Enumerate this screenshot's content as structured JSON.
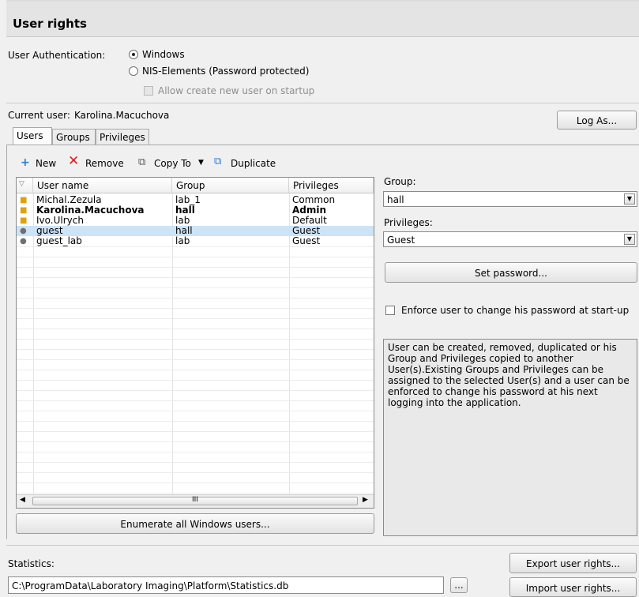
{
  "title": "User rights",
  "auth": {
    "label": "User Authentication:",
    "options": [
      {
        "label": "Windows",
        "selected": true
      },
      {
        "label": "NIS-Elements (Password protected)",
        "selected": false
      }
    ],
    "allow_create_label": "Allow create new user on startup"
  },
  "current_user": {
    "label": "Current user:",
    "value": "Karolina.Macuchova"
  },
  "log_as_label": "Log As...",
  "tabs": [
    {
      "label": "Users",
      "active": true
    },
    {
      "label": "Groups",
      "active": false
    },
    {
      "label": "Privileges",
      "active": false
    }
  ],
  "toolbar": {
    "new_label": "New",
    "remove_label": "Remove",
    "copy_to_label": "Copy To",
    "duplicate_label": "Duplicate"
  },
  "table": {
    "columns": [
      "User name",
      "Group",
      "Privileges"
    ],
    "rows": [
      {
        "user": "Michal.Zezula",
        "group": "lab_1",
        "privileges": "Common",
        "icon": "windows-user-icon",
        "bold": false,
        "selected": false
      },
      {
        "user": "Karolina.Macuchova",
        "group": "hall",
        "privileges": "Admin",
        "icon": "windows-user-icon",
        "bold": true,
        "selected": false
      },
      {
        "user": "Ivo.Ulrych",
        "group": "lab",
        "privileges": "Default",
        "icon": "windows-user-icon",
        "bold": false,
        "selected": false
      },
      {
        "user": "guest",
        "group": "hall",
        "privileges": "Guest",
        "icon": "local-user-icon",
        "bold": false,
        "selected": true
      },
      {
        "user": "guest_lab",
        "group": "lab",
        "privileges": "Guest",
        "icon": "local-user-icon",
        "bold": false,
        "selected": false
      }
    ],
    "scrollbar_grip": "III"
  },
  "enumerate_label": "Enumerate all Windows users...",
  "right_panel": {
    "group_label": "Group:",
    "group_value": "hall",
    "privileges_label": "Privileges:",
    "privileges_value": "Guest",
    "set_password_label": "Set password...",
    "enforce_label": "Enforce user to change his password at start-up",
    "help_text": "User can be created, removed, duplicated or his Group and Privileges copied to another User(s).Existing Groups and Privileges can be assigned to the selected User(s) and a user can be enforced to change his password at his next logging into the application."
  },
  "statistics": {
    "label": "Statistics:",
    "path": "C:\\ProgramData\\Laboratory Imaging\\Platform\\Statistics.db",
    "browse_label": "...",
    "export_label": "Export user rights...",
    "import_label": "Import user rights..."
  },
  "colors": {
    "selection": "#cde3f8",
    "remove_red": "#d62020",
    "new_blue": "#2d7bd6"
  }
}
